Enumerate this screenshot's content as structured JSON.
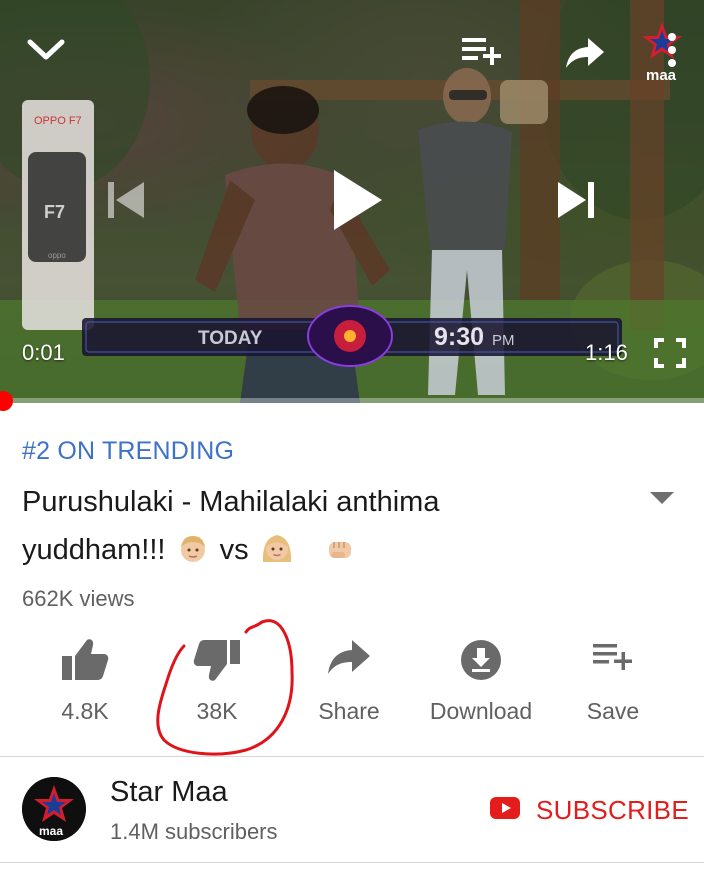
{
  "player": {
    "current_time": "0:01",
    "duration": "1:16",
    "progress_fraction": 0.01,
    "banner": {
      "left_text": "TODAY",
      "right_time": "9:30",
      "right_suffix": "PM"
    },
    "phone_ad": {
      "brand": "OPPO F7",
      "model": "F7",
      "brand_small": "oppo"
    },
    "channel_logo_text": "maa",
    "icons": {
      "minimize": "chevron-down-icon",
      "add_to_queue": "playlist-add-icon",
      "share": "share-arrow-icon",
      "menu": "more-vert-icon",
      "previous": "skip-previous-icon",
      "play": "play-icon",
      "next": "skip-next-icon",
      "fullscreen": "fullscreen-icon"
    }
  },
  "video": {
    "trending": "#2 ON TRENDING",
    "title_line1": "Purushulaki - Mahilalaki anthima",
    "title_line2_text": "yuddham!!!",
    "title_vs": "vs",
    "views": "662K views"
  },
  "actions": {
    "like": {
      "label": "4.8K",
      "icon": "thumbs-up-icon"
    },
    "dislike": {
      "label": "38K",
      "icon": "thumbs-down-icon"
    },
    "share": {
      "label": "Share",
      "icon": "share-icon"
    },
    "download": {
      "label": "Download",
      "icon": "download-icon"
    },
    "save": {
      "label": "Save",
      "icon": "playlist-add-icon"
    }
  },
  "channel": {
    "name": "Star Maa",
    "subscribers": "1.4M subscribers",
    "subscribe_label": "SUBSCRIBE",
    "avatar_text": "maa"
  },
  "colors": {
    "accent_red": "#e31c1c",
    "trending_blue": "#3e72c9",
    "progress_red": "#ff0000",
    "annotation_red": "#e0121a"
  }
}
